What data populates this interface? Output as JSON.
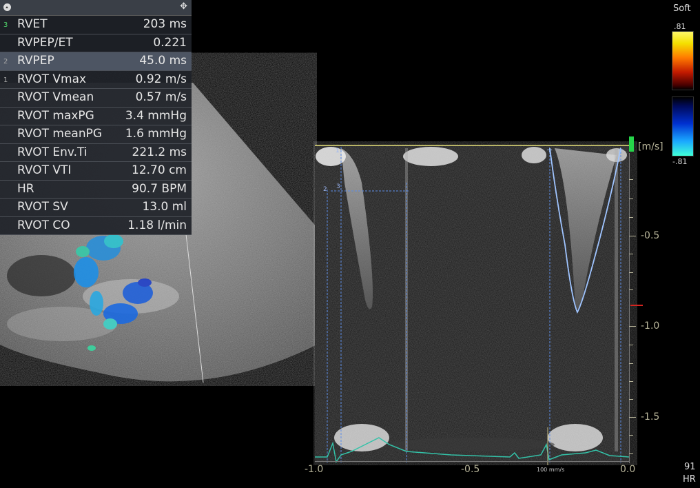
{
  "measurements": {
    "rows": [
      {
        "index": "3",
        "name": "RVET",
        "value": "203 ms"
      },
      {
        "index": "",
        "name": "RVPEP/ET",
        "value": "0.221"
      },
      {
        "index": "2",
        "name": "RVPEP",
        "value": "45.0 ms"
      },
      {
        "index": "1",
        "name": "RVOT Vmax",
        "value": "0.92 m/s"
      },
      {
        "index": "",
        "name": "RVOT Vmean",
        "value": "0.57 m/s"
      },
      {
        "index": "",
        "name": "RVOT maxPG",
        "value": "3.4 mmHg"
      },
      {
        "index": "",
        "name": "RVOT meanPG",
        "value": "1.6 mmHg"
      },
      {
        "index": "",
        "name": "RVOT Env.Ti",
        "value": "221.2 ms"
      },
      {
        "index": "",
        "name": "RVOT VTI",
        "value": "12.70 cm"
      },
      {
        "index": "",
        "name": "HR",
        "value": "90.7 BPM"
      },
      {
        "index": "",
        "name": "RVOT SV",
        "value": "13.0 ml"
      },
      {
        "index": "",
        "name": "RVOT CO",
        "value": "1.18 l/min"
      }
    ]
  },
  "colorbar": {
    "preset": "Soft",
    "top_label": ".81",
    "bottom_label": "-.81"
  },
  "doppler": {
    "unit": "[m/s]",
    "y_labels": [
      "-0.5",
      "-1.0",
      "-1.5"
    ],
    "x_labels": [
      "-1.0",
      "-0.5",
      "0.0"
    ],
    "sweep_label": "100 mm/s",
    "caliper_labels": [
      "1",
      "2",
      "3"
    ]
  },
  "hr": {
    "value": "91",
    "label": "HR"
  }
}
